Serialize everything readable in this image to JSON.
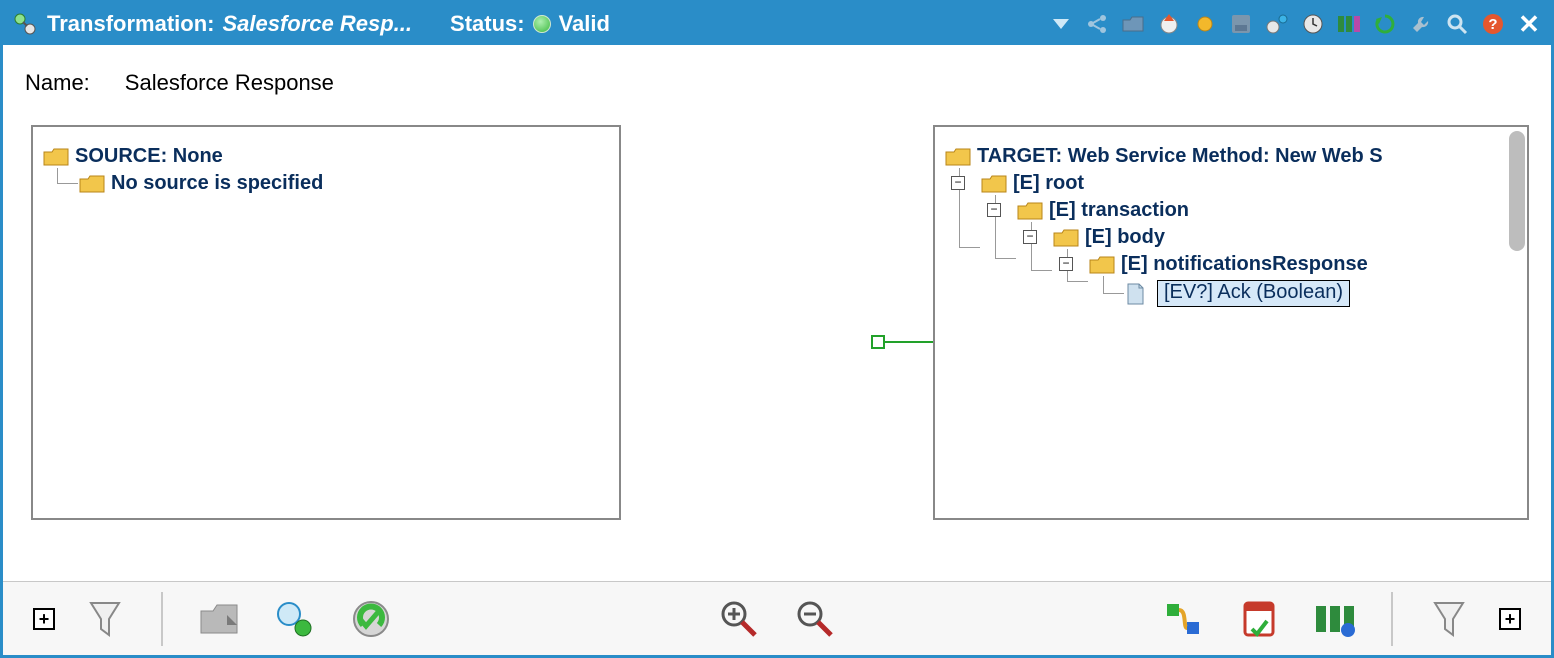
{
  "titlebar": {
    "labelPrefix": "Transformation:",
    "titleName": "Salesforce Resp...",
    "statusLabel": "Status:",
    "statusText": "Valid"
  },
  "nameRow": {
    "label": "Name:",
    "value": "Salesforce Response"
  },
  "sourcePanel": {
    "root": "SOURCE: None",
    "child": "No source is specified"
  },
  "targetPanel": {
    "root": "TARGET: Web Service Method: New Web S",
    "nodes": {
      "e_root": "[E] root",
      "e_transaction": "[E] transaction",
      "e_body": "[E] body",
      "e_notificationsResponse": "[E] notificationsResponse",
      "leaf_ack": "[EV?] Ack  (Boolean)"
    }
  }
}
